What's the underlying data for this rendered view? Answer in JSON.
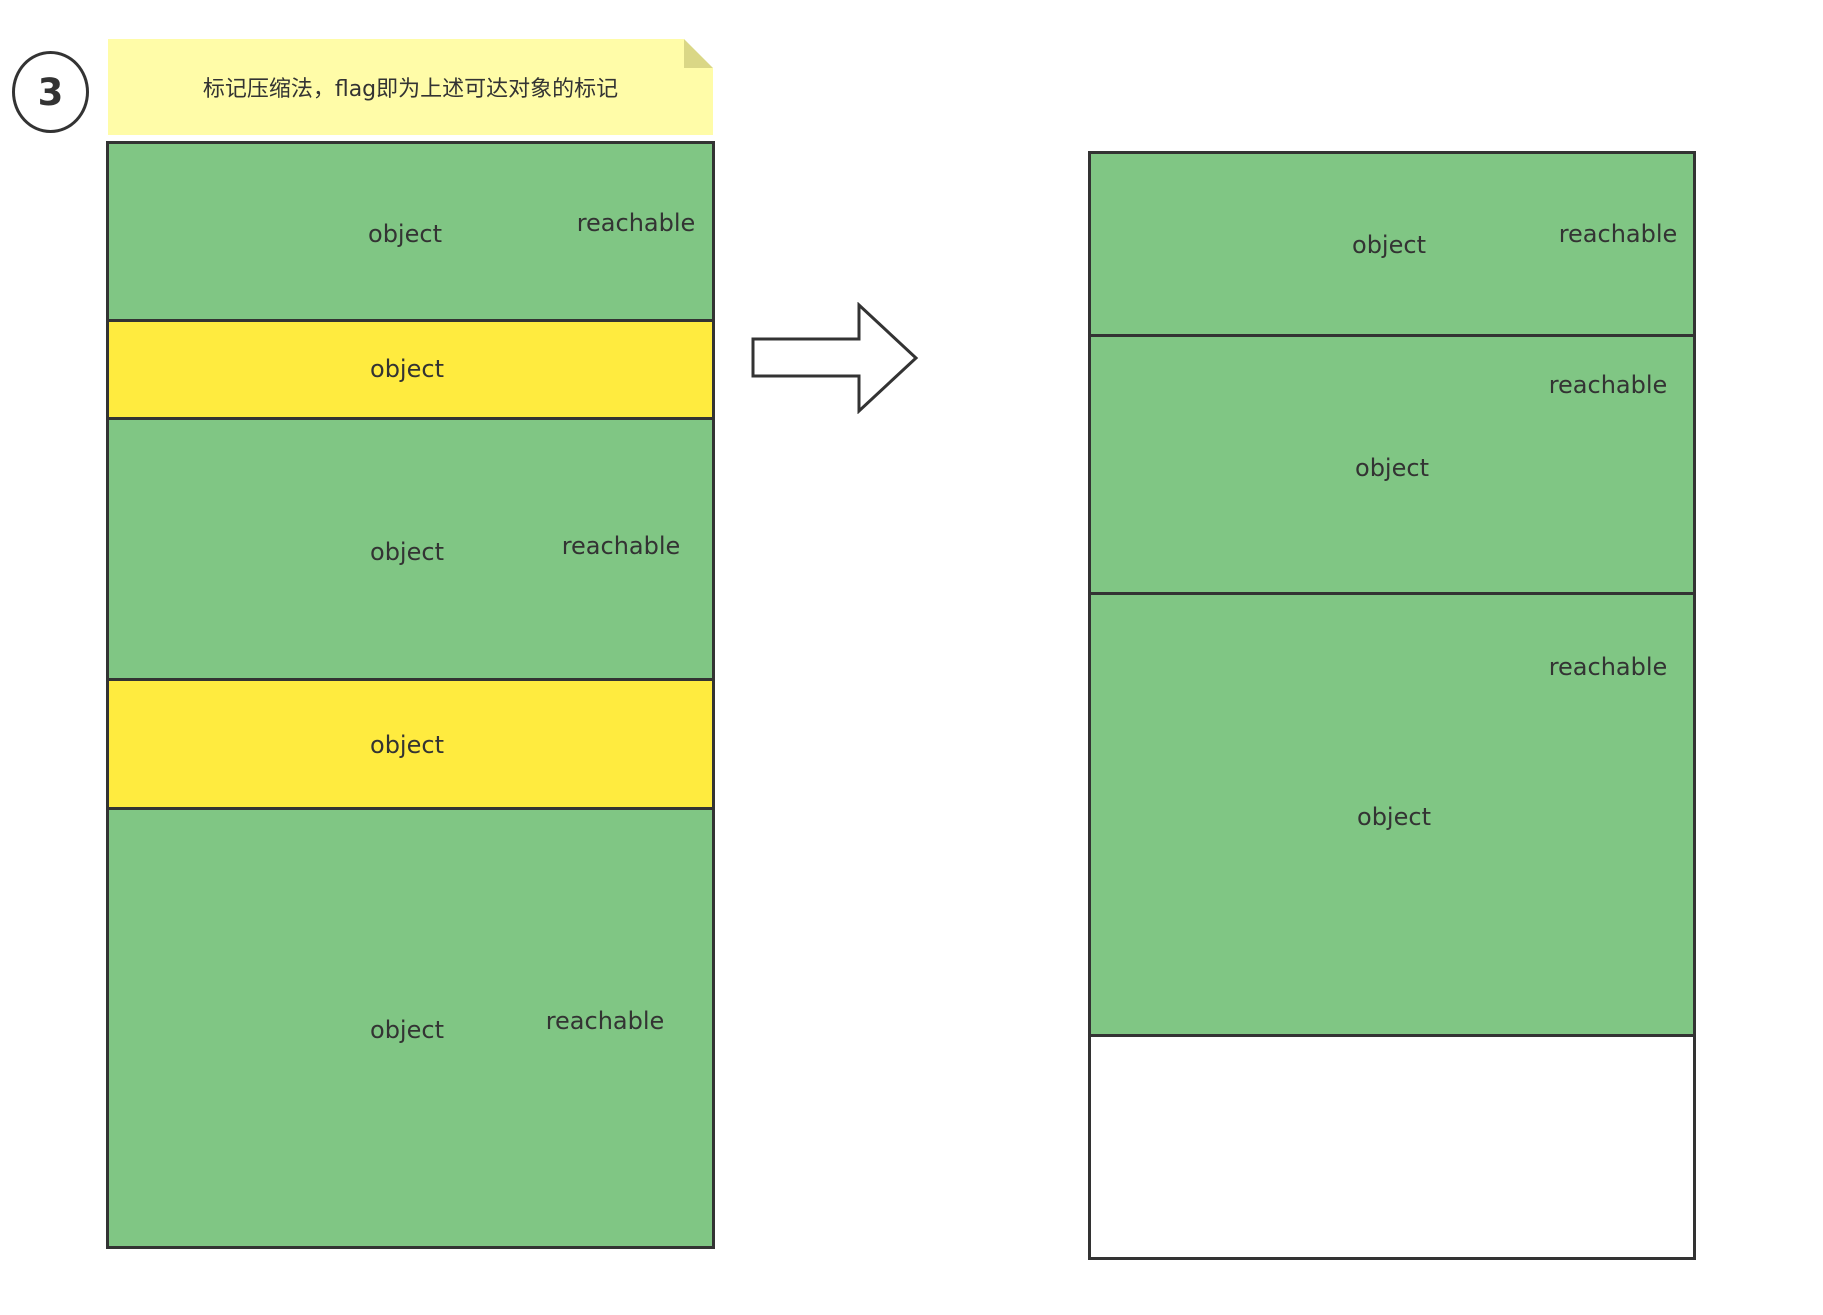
{
  "step": {
    "number": "3"
  },
  "note": {
    "text": "标记压缩法，flag即为上述可达对象的标记",
    "color": "#fffca8"
  },
  "colors": {
    "reachable_fill": "#80c684",
    "unreachable_fill": "#ffeb3f",
    "free_fill": "#ffffff",
    "outline": "#333333"
  },
  "before": {
    "blocks": [
      {
        "type": "reachable",
        "object_label": "object",
        "flag_label": "reachable"
      },
      {
        "type": "unreachable",
        "object_label": "object"
      },
      {
        "type": "reachable",
        "object_label": "object",
        "flag_label": "reachable"
      },
      {
        "type": "unreachable",
        "object_label": "object"
      },
      {
        "type": "reachable",
        "object_label": "object",
        "flag_label": "reachable"
      }
    ]
  },
  "arrow": {
    "icon": "right-arrow-icon"
  },
  "after": {
    "blocks": [
      {
        "type": "reachable",
        "object_label": "object",
        "flag_label": "reachable"
      },
      {
        "type": "reachable",
        "object_label": "object",
        "flag_label": "reachable"
      },
      {
        "type": "reachable",
        "object_label": "object",
        "flag_label": "reachable"
      },
      {
        "type": "free"
      }
    ]
  }
}
